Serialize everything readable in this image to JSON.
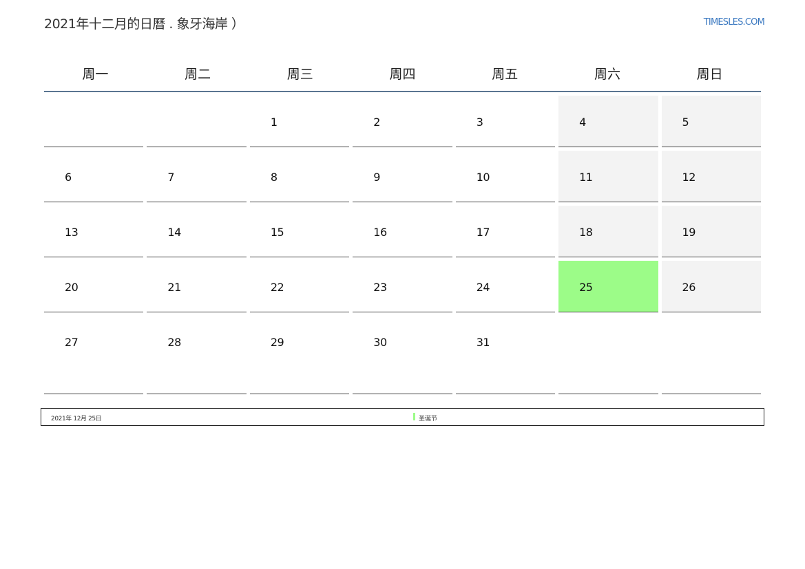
{
  "header": {
    "title": "2021年十二月的日曆 . 象牙海岸 ）",
    "site": "TIMESLES.COM"
  },
  "weekdays": [
    "周一",
    "周二",
    "周三",
    "周四",
    "周五",
    "周六",
    "周日"
  ],
  "weeks": [
    [
      "",
      "",
      "1",
      "2",
      "3",
      "4",
      "5"
    ],
    [
      "6",
      "7",
      "8",
      "9",
      "10",
      "11",
      "12"
    ],
    [
      "13",
      "14",
      "15",
      "16",
      "17",
      "18",
      "19"
    ],
    [
      "20",
      "21",
      "22",
      "23",
      "24",
      "25",
      "26"
    ],
    [
      "27",
      "28",
      "29",
      "30",
      "31",
      "",
      ""
    ]
  ],
  "holiday": {
    "date_label": "2021年 12月 25日",
    "name": "圣诞节",
    "day": "25",
    "color": "#9cfc88"
  },
  "colors": {
    "weekend_bg": "#f3f3f3",
    "header_rule": "#5a7491",
    "site_link": "#3a78c0"
  }
}
